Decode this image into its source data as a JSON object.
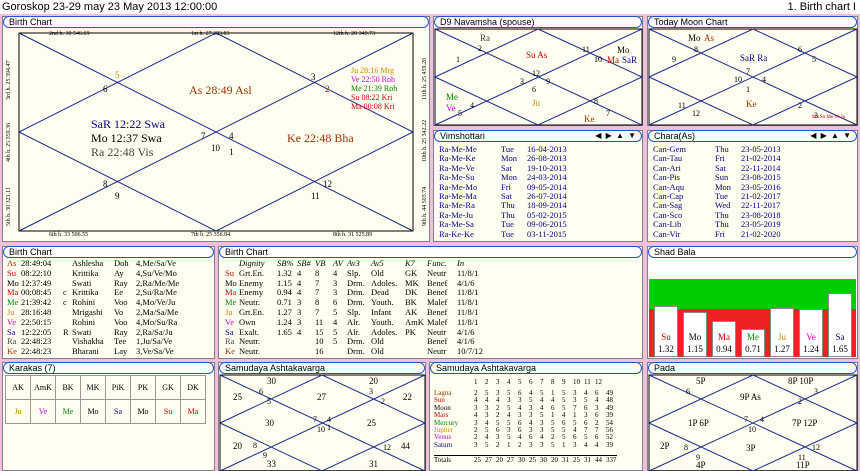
{
  "title": {
    "left": "Goroskop 23-29 may  23 May 2013 12:00:00",
    "right": "1. Birth chart I"
  },
  "colors": {
    "panel_bg": "#fffef0",
    "border_blue": "#2255cc",
    "pink": "#f0c0d8",
    "red": "#cc0000",
    "green": "#008800",
    "blue": "#0000cc",
    "magenta": "#cc00cc",
    "orange": "#cc8800",
    "brown": "#993300",
    "navy": "#000080"
  },
  "birth_chart": {
    "header": "Birth Chart",
    "top_labels": [
      "2nd h.  30  546.69",
      "1st h.  27  383.83",
      "12th h.  20  349.73"
    ],
    "bottom_labels": [
      "6th h.  33  506.55",
      "7th h.  25  356.84",
      "8th h.  31  525.89"
    ],
    "left_labels": [
      "3rd h.  25  394.47",
      "4th h.  25  359.36",
      "5th h.  30  321.11"
    ],
    "right_labels": [
      "11th h.  25  459.20",
      "10th h.  25  342.22",
      "9th h.  44  503.74"
    ],
    "numbers": [
      "5",
      "6",
      "3",
      "2",
      "7",
      "4",
      "10",
      "1",
      "8",
      "9",
      "12",
      "11"
    ],
    "planets": {
      "as": "As 28:49 Asl",
      "sar": "SaR 12:22 Swa",
      "mo": "Mo 12:37 Swa",
      "ra": "Ra 22:48 Vis",
      "ke": "Ke 22:48 Bha",
      "ju": "Ju 28:16 Mrg",
      "ve": "Ve 22:50 Roh",
      "me": "Me 21:39 Roh",
      "su": "Su 08:22 Kri",
      "ma": "Ma 00:08 Kri"
    }
  },
  "d9": {
    "header": "D9 Navamsha  (spouse)",
    "ra": "Ra",
    "su_as": "Su As",
    "mo": "Mo",
    "ma": "Ma",
    "sar": "SaR",
    "me": "Me",
    "ve": "Ve",
    "ju": "Ju",
    "ke": "Ke",
    "numbers": [
      "2",
      "1",
      "11",
      "10",
      "12",
      "3",
      "9",
      "4",
      "6",
      "8",
      "5",
      "7"
    ]
  },
  "moon": {
    "header": "Today Moon Chart",
    "mo": "Mo",
    "as": "As",
    "sar_ra": "SaR Ra",
    "ke": "Ke",
    "small": "Ma Su Me Ve Ju",
    "numbers": [
      "8",
      "6",
      "5",
      "9",
      "7",
      "10",
      "4",
      "1",
      "11",
      "12",
      "2",
      "3"
    ]
  },
  "vimshottari": {
    "header": "Vimshottari",
    "nav": "◀ ▶ ▲ ▼",
    "rows": [
      [
        "Ra-Me-Me",
        "Tue",
        "16-04-2013"
      ],
      [
        "Ra-Me-Ke",
        "Mon",
        "26-08-2013"
      ],
      [
        "Ra-Me-Ve",
        "Sat",
        "19-10-2013"
      ],
      [
        "Ra-Me-Su",
        "Mon",
        "24-03-2014"
      ],
      [
        "Ra-Me-Mo",
        "Fri",
        "09-05-2014"
      ],
      [
        "Ra-Me-Ma",
        "Sat",
        "26-07-2014"
      ],
      [
        "Ra-Me-Ra",
        "Thu",
        "18-09-2014"
      ],
      [
        "Ra-Me-Ju",
        "Thu",
        "05-02-2015"
      ],
      [
        "Ra-Me-Sa",
        "Tue",
        "09-06-2015"
      ],
      [
        "Ra-Ke-Ke",
        "Tue",
        "03-11-2015"
      ]
    ]
  },
  "chara": {
    "header": "Chara(As)",
    "nav": "◀ ▶ ▲ ▼",
    "rows": [
      [
        "Can-Gem",
        "Thu",
        "23-05-2013"
      ],
      [
        "Can-Tau",
        "Fri",
        "21-02-2014"
      ],
      [
        "Can-Ari",
        "Sat",
        "22-11-2014"
      ],
      [
        "Can-Pis",
        "Sun",
        "23-08-2015"
      ],
      [
        "Can-Aqu",
        "Mon",
        "23-05-2016"
      ],
      [
        "Can-Cap",
        "Tue",
        "21-02-2017"
      ],
      [
        "Can-Sag",
        "Wed",
        "22-11-2017"
      ],
      [
        "Can-Sco",
        "Thu",
        "23-08-2018"
      ],
      [
        "Can-Lib",
        "Thu",
        "23-05-2019"
      ],
      [
        "Can-Vir",
        "Fri",
        "21-02-2020"
      ]
    ]
  },
  "birth_table1": {
    "header": "Birth Chart",
    "rows": [
      [
        "As",
        "28:49:04",
        "",
        "Ashlesha",
        "Doh",
        "4,Me/Sa/Ve"
      ],
      [
        "Su",
        "08:22:10",
        "",
        "Krittika",
        "Ay",
        "4,Su/Ve/Mo"
      ],
      [
        "Mo",
        "12:37:49",
        "",
        "Swati",
        "Ray",
        "2,Ra/Me/Me"
      ],
      [
        "Ma",
        "00:08:45",
        "c",
        "Krittika",
        "Ee",
        "2,Su/Ra/Me"
      ],
      [
        "Me",
        "21:39:42",
        "c",
        "Rohini",
        "Voo",
        "4,Mo/Ve/Ju"
      ],
      [
        "Ju",
        "28:16:48",
        "",
        "Mrigashi",
        "Vo",
        "2,Ma/Sa/Me"
      ],
      [
        "Ve",
        "22:50:15",
        "",
        "Rohini",
        "Voo",
        "4,Mo/Su/Ra"
      ],
      [
        "Sa",
        "12:22:05",
        "R",
        "Swati",
        "Ray",
        "2,Ra/Sa/Ju"
      ],
      [
        "Ra",
        "22:48:23",
        "",
        "Vishakha",
        "Tee",
        "1,Ju/Sa/Ve"
      ],
      [
        "Ke",
        "22:48:23",
        "",
        "Bharani",
        "Lay",
        "3,Ve/Sa/Ve"
      ]
    ]
  },
  "birth_table2": {
    "header": "Birth Chart",
    "cols": [
      "",
      "Dignity",
      "SB%",
      "SB#",
      "VB",
      "AV",
      "Av3",
      "Av5",
      "K7",
      "Func.",
      "In"
    ],
    "rows": [
      [
        "Su",
        "Grt.En.",
        "1.32",
        "4",
        "8",
        "4",
        "Slp.",
        "Old",
        "GK",
        "Neutr",
        "11/8/1"
      ],
      [
        "Mo",
        "Enemy",
        "1.15",
        "4",
        "7",
        "3",
        "Drm.",
        "Adoles.",
        "MK",
        "Benef",
        "4/1/6"
      ],
      [
        "Ma",
        "Enemy",
        "0.94",
        "4",
        "7",
        "3",
        "Drm.",
        "Dead",
        "DK",
        "Benef",
        "11/8/1"
      ],
      [
        "Me",
        "Neutr.",
        "0.71",
        "3",
        "8",
        "6",
        "Drm.",
        "Youth.",
        "BK",
        "Malef",
        "11/8/1"
      ],
      [
        "Ju",
        "Grt.En.",
        "1.27",
        "3",
        "7",
        "5",
        "Slp.",
        "Infant",
        "AK",
        "Benef",
        "11/8/1"
      ],
      [
        "Ve",
        "Own",
        "1.24",
        "3",
        "11",
        "4",
        "Alr.",
        "Youth.",
        "AmK",
        "Malef",
        "11/8/1"
      ],
      [
        "Sa",
        "Exalt.",
        "1.65",
        "4",
        "15",
        "5",
        "Alr.",
        "Adoles.",
        "PK",
        "Neutr",
        "4/1/6"
      ],
      [
        "Ra",
        "Neutr.",
        "",
        "",
        "10",
        "5",
        "Drm.",
        "Old",
        "",
        "Benef",
        "4/1/6"
      ],
      [
        "Ke",
        "Neutr.",
        "",
        "",
        "16",
        "",
        "Drm.",
        "Old",
        "",
        "Neutr",
        "10/7/12"
      ]
    ]
  },
  "shad_bala": {
    "header": "Shad Bala",
    "bars": [
      {
        "p": "Su",
        "v": "1.32",
        "n": 1.32
      },
      {
        "p": "Mo",
        "v": "1.15",
        "n": 1.15
      },
      {
        "p": "Ma",
        "v": "0.94",
        "n": 0.94
      },
      {
        "p": "Me",
        "v": "0.71",
        "n": 0.71
      },
      {
        "p": "Ju",
        "v": "1.27",
        "n": 1.27
      },
      {
        "p": "Ve",
        "v": "1.24",
        "n": 1.24
      },
      {
        "p": "Sa",
        "v": "1.65",
        "n": 1.65
      }
    ]
  },
  "karakas": {
    "header": "Karakas  (7)",
    "top": [
      "AK",
      "AmK",
      "BK",
      "MK",
      "PiK",
      "PK",
      "GK",
      "DK"
    ],
    "bottom": [
      "Ju",
      "Ve",
      "Me",
      "Mo",
      "Sa",
      "Mo",
      "Su",
      "Ma"
    ]
  },
  "samudaya1": {
    "header": "Samudaya Ashtakavarga",
    "n": [
      "30",
      "20",
      "25",
      "6",
      "5",
      "27",
      "2",
      "3",
      "22",
      "30",
      "7",
      "4",
      "10",
      "1",
      "25",
      "20",
      "8",
      "9",
      "12",
      "44",
      "33",
      "31"
    ]
  },
  "samudaya2": {
    "header": "Samudaya Ashtakavarga",
    "cols": [
      "1",
      "2",
      "3",
      "4",
      "5",
      "6",
      "7",
      "8",
      "9",
      "10",
      "11",
      "12"
    ],
    "rows": [
      [
        "Lagna",
        "2",
        "5",
        "3",
        "5",
        "6",
        "4",
        "5",
        "1",
        "5",
        "3",
        "4",
        "6",
        "49"
      ],
      [
        "Sun",
        "4",
        "4",
        "4",
        "3",
        "3",
        "5",
        "4",
        "4",
        "5",
        "3",
        "5",
        "4",
        "48"
      ],
      [
        "Moon",
        "3",
        "3",
        "2",
        "5",
        "4",
        "3",
        "4",
        "6",
        "5",
        "7",
        "6",
        "3",
        "49"
      ],
      [
        "Mars",
        "4",
        "3",
        "2",
        "4",
        "3",
        "3",
        "5",
        "1",
        "4",
        "1",
        "3",
        "6",
        "39"
      ],
      [
        "Mercury",
        "3",
        "4",
        "5",
        "5",
        "6",
        "4",
        "3",
        "5",
        "6",
        "5",
        "6",
        "2",
        "54"
      ],
      [
        "Jupiter",
        "2",
        "5",
        "6",
        "3",
        "6",
        "3",
        "3",
        "5",
        "5",
        "4",
        "7",
        "7",
        "56"
      ],
      [
        "Venus",
        "2",
        "4",
        "3",
        "5",
        "4",
        "6",
        "4",
        "2",
        "5",
        "6",
        "5",
        "6",
        "52"
      ],
      [
        "Saturn",
        "3",
        "5",
        "2",
        "1",
        "2",
        "3",
        "3",
        "5",
        "1",
        "3",
        "4",
        "4",
        "39"
      ]
    ],
    "totals": [
      "Totals",
      "25",
      "27",
      "20",
      "27",
      "30",
      "25",
      "30",
      "20",
      "31",
      "25",
      "31",
      "44",
      "337"
    ]
  },
  "pada": {
    "header": "Pada",
    "n": [
      "5P",
      "8P 10P",
      "6",
      "9P As",
      "3",
      "2",
      "1P 6P",
      "7",
      "4",
      "7P 12P",
      "10",
      "2P",
      "8",
      "9",
      "3P",
      "12",
      "11",
      "4P",
      "11P"
    ]
  }
}
